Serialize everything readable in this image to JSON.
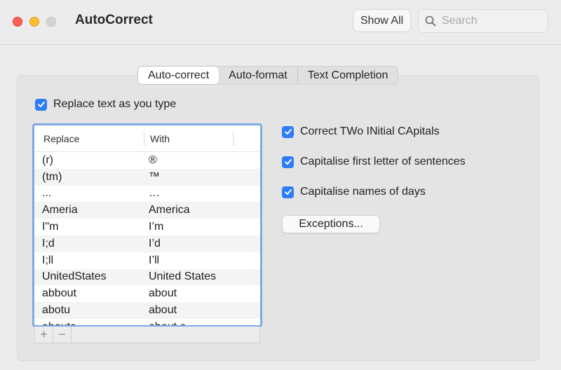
{
  "window": {
    "title": "AutoCorrect",
    "show_all_label": "Show All",
    "search_placeholder": "Search"
  },
  "tabs": [
    {
      "label": "Auto-correct",
      "active": true
    },
    {
      "label": "Auto-format",
      "active": false
    },
    {
      "label": "Text Completion",
      "active": false
    }
  ],
  "replace_text": {
    "label": "Replace text as you type",
    "checked": true
  },
  "table": {
    "headers": {
      "replace": "Replace",
      "with": "With"
    },
    "rows": [
      {
        "replace": "(r)",
        "with": "®"
      },
      {
        "replace": "(tm)",
        "with": "™"
      },
      {
        "replace": "...",
        "with": "…"
      },
      {
        "replace": "Ameria",
        "with": "America"
      },
      {
        "replace": "I\"m",
        "with": "I’m"
      },
      {
        "replace": "I;d",
        "with": "I’d"
      },
      {
        "replace": "I;ll",
        "with": "I’ll"
      },
      {
        "replace": "UnitedStates",
        "with": "United States"
      },
      {
        "replace": "abbout",
        "with": "about"
      },
      {
        "replace": "abotu",
        "with": "about"
      },
      {
        "replace": "abouta",
        "with": "about a"
      }
    ]
  },
  "options": [
    {
      "label": "Correct TWo INitial CApitals",
      "checked": true
    },
    {
      "label": "Capitalise first letter of sentences",
      "checked": true
    },
    {
      "label": "Capitalise names of days",
      "checked": true
    }
  ],
  "exceptions_label": "Exceptions...",
  "list_controls": {
    "add": "+",
    "remove": "−"
  },
  "colors": {
    "accent": "#2e7cf6",
    "selection_border": "#7fa8e6"
  }
}
